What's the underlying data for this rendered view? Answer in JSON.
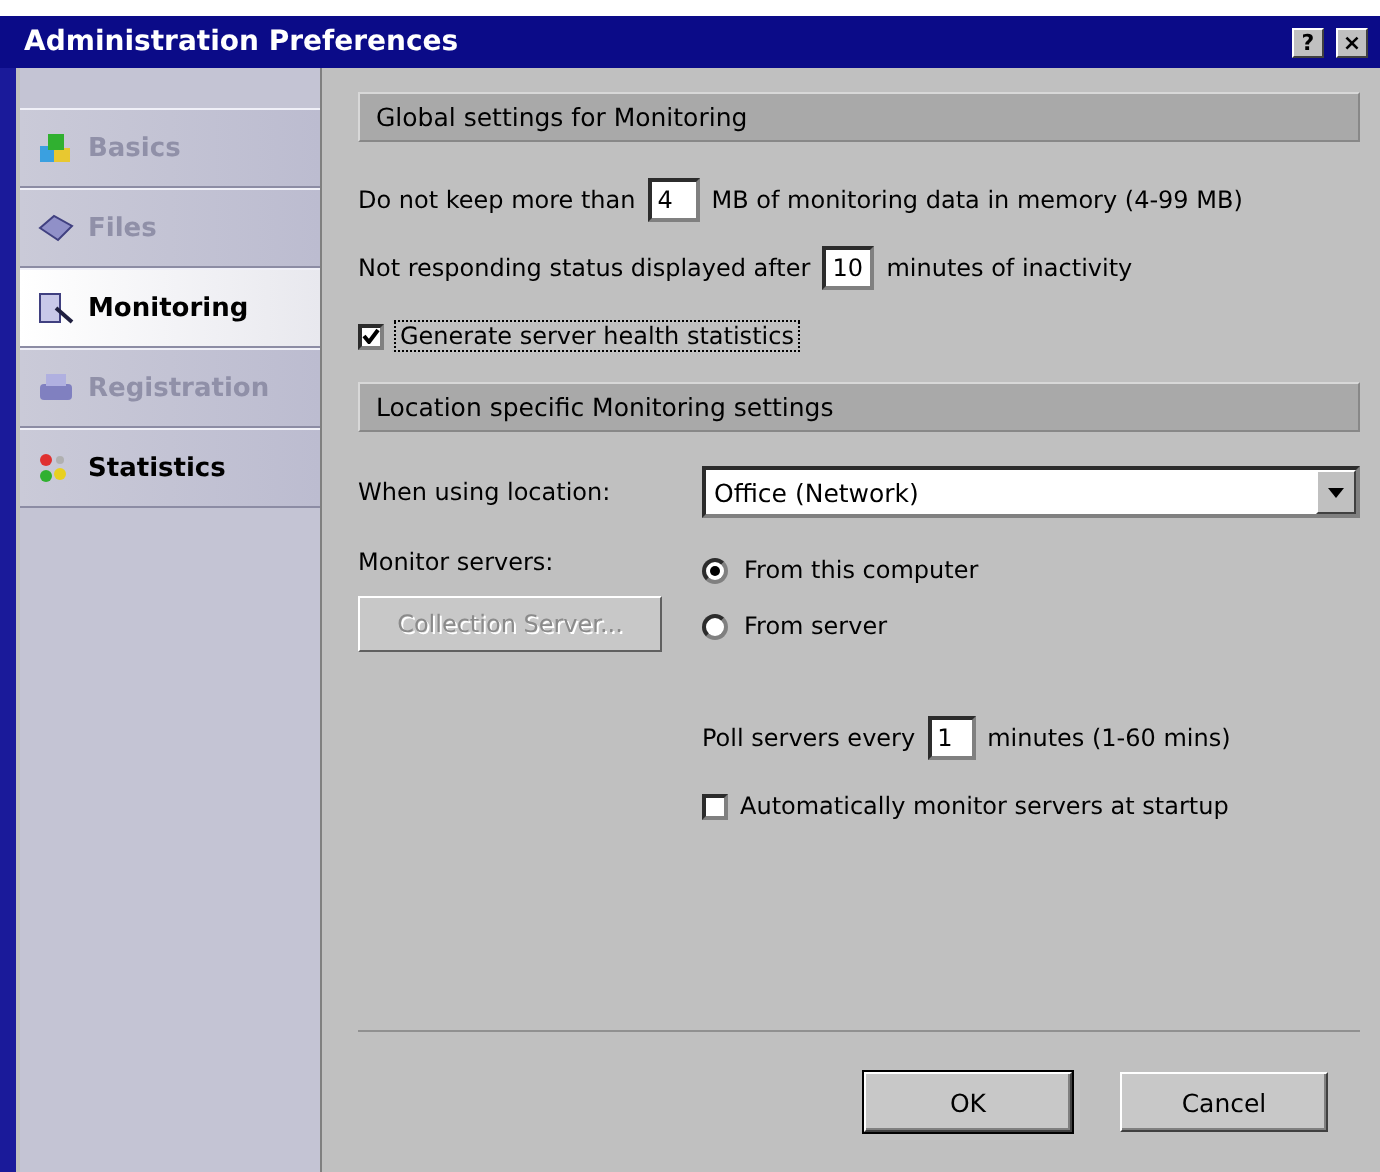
{
  "window": {
    "title": "Administration Preferences",
    "buttons": [
      "?",
      "×"
    ]
  },
  "sidebar": {
    "items": [
      {
        "label": "Basics",
        "selected": false,
        "disabled": true
      },
      {
        "label": "Files",
        "selected": false,
        "disabled": true
      },
      {
        "label": "Monitoring",
        "selected": true,
        "disabled": false
      },
      {
        "label": "Registration",
        "selected": false,
        "disabled": true
      },
      {
        "label": "Statistics",
        "selected": false,
        "disabled": false
      }
    ]
  },
  "global_section": {
    "title": "Global settings for Monitoring",
    "memory_row": {
      "before": "Do not keep more than",
      "value": "4",
      "after": "MB of monitoring data in memory (4-99 MB)"
    },
    "timeout_row": {
      "before": "Not responding status displayed after",
      "value": "10",
      "after": "minutes of inactivity"
    },
    "health_stats": {
      "label": "Generate server health statistics",
      "checked": true
    }
  },
  "location_section": {
    "title": "Location specific Monitoring settings",
    "location": {
      "label": "When using location:",
      "value": "Office (Network)"
    },
    "monitor_label": "Monitor servers:",
    "collection_button": {
      "label": "Collection Server...",
      "disabled": true
    },
    "monitor_options": [
      {
        "label": "From this computer",
        "selected": true
      },
      {
        "label": "From server",
        "selected": false
      }
    ],
    "poll_row": {
      "before": "Poll servers every",
      "value": "1",
      "after": "minutes (1-60 mins)"
    },
    "auto_monitor": {
      "label": "Automatically monitor servers at startup",
      "checked": false
    }
  },
  "buttons": [
    "OK",
    "Cancel"
  ]
}
